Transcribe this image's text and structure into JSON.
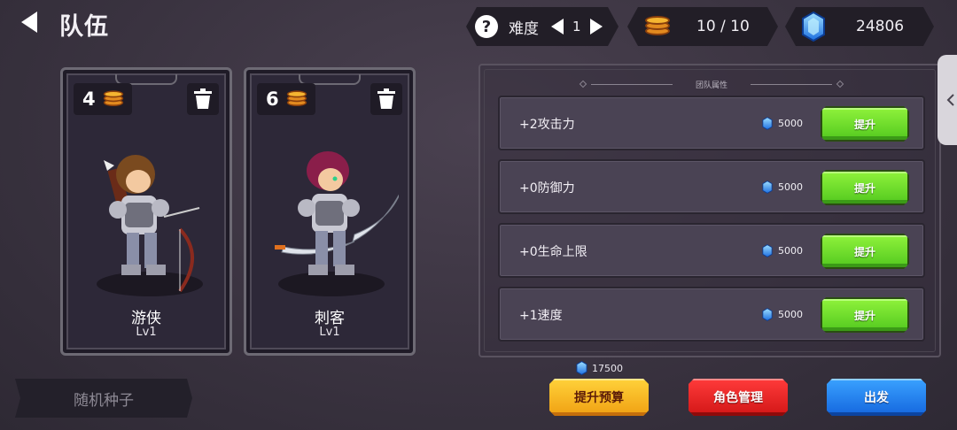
{
  "header": {
    "title": "队伍",
    "difficulty_label": "难度",
    "difficulty_value": "1",
    "coins": "10 / 10",
    "gems": "24806"
  },
  "characters": [
    {
      "name": "游侠",
      "level": "Lv1",
      "cost": "4"
    },
    {
      "name": "刺客",
      "level": "Lv1",
      "cost": "6"
    }
  ],
  "seed_button": "随机种子",
  "team_panel": {
    "title": "团队属性",
    "stats": [
      {
        "label": "+2攻击力",
        "cost": "5000",
        "button": "提升"
      },
      {
        "label": "+0防御力",
        "cost": "5000",
        "button": "提升"
      },
      {
        "label": "+0生命上限",
        "cost": "5000",
        "button": "提升"
      },
      {
        "label": "+1速度",
        "cost": "5000",
        "button": "提升"
      }
    ]
  },
  "bottom": {
    "budget_cost": "17500",
    "budget_button": "提升预算",
    "role_button": "角色管理",
    "go_button": "出发"
  },
  "colors": {
    "upgrade_green": "#6edc2a",
    "budget_yellow": "#f5b82a",
    "role_red": "#e52222",
    "go_blue": "#2a86f0",
    "gem_blue": "#3aa0ff"
  }
}
